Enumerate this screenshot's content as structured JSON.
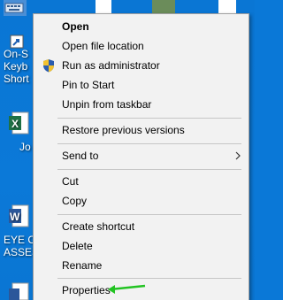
{
  "desktop": {
    "icons": [
      {
        "label_lines": [
          "On-S",
          "Keyb",
          "Short"
        ],
        "name": "on-screen-keyboard-shortcut"
      },
      {
        "label_lines": [
          "Jo"
        ],
        "name": "excel-file"
      },
      {
        "label_lines": [
          "EYE C",
          "ASSES"
        ],
        "name": "word-file"
      }
    ]
  },
  "menu": {
    "items": [
      {
        "label": "Open",
        "bold": true
      },
      {
        "label": "Open file location"
      },
      {
        "label": "Run as administrator",
        "icon": "uac-shield-icon"
      },
      {
        "label": "Pin to Start"
      },
      {
        "label": "Unpin from taskbar"
      },
      {
        "label": "Restore previous versions"
      },
      {
        "label": "Send to",
        "submenu": true
      },
      {
        "label": "Cut"
      },
      {
        "label": "Copy"
      },
      {
        "label": "Create shortcut"
      },
      {
        "label": "Delete"
      },
      {
        "label": "Rename"
      },
      {
        "label": "Properties"
      }
    ]
  },
  "colors": {
    "desktop": "#0a78d7",
    "menu_bg": "#f2f2f2",
    "separator": "#c6c6c6",
    "annotation_arrow": "#22c322"
  }
}
